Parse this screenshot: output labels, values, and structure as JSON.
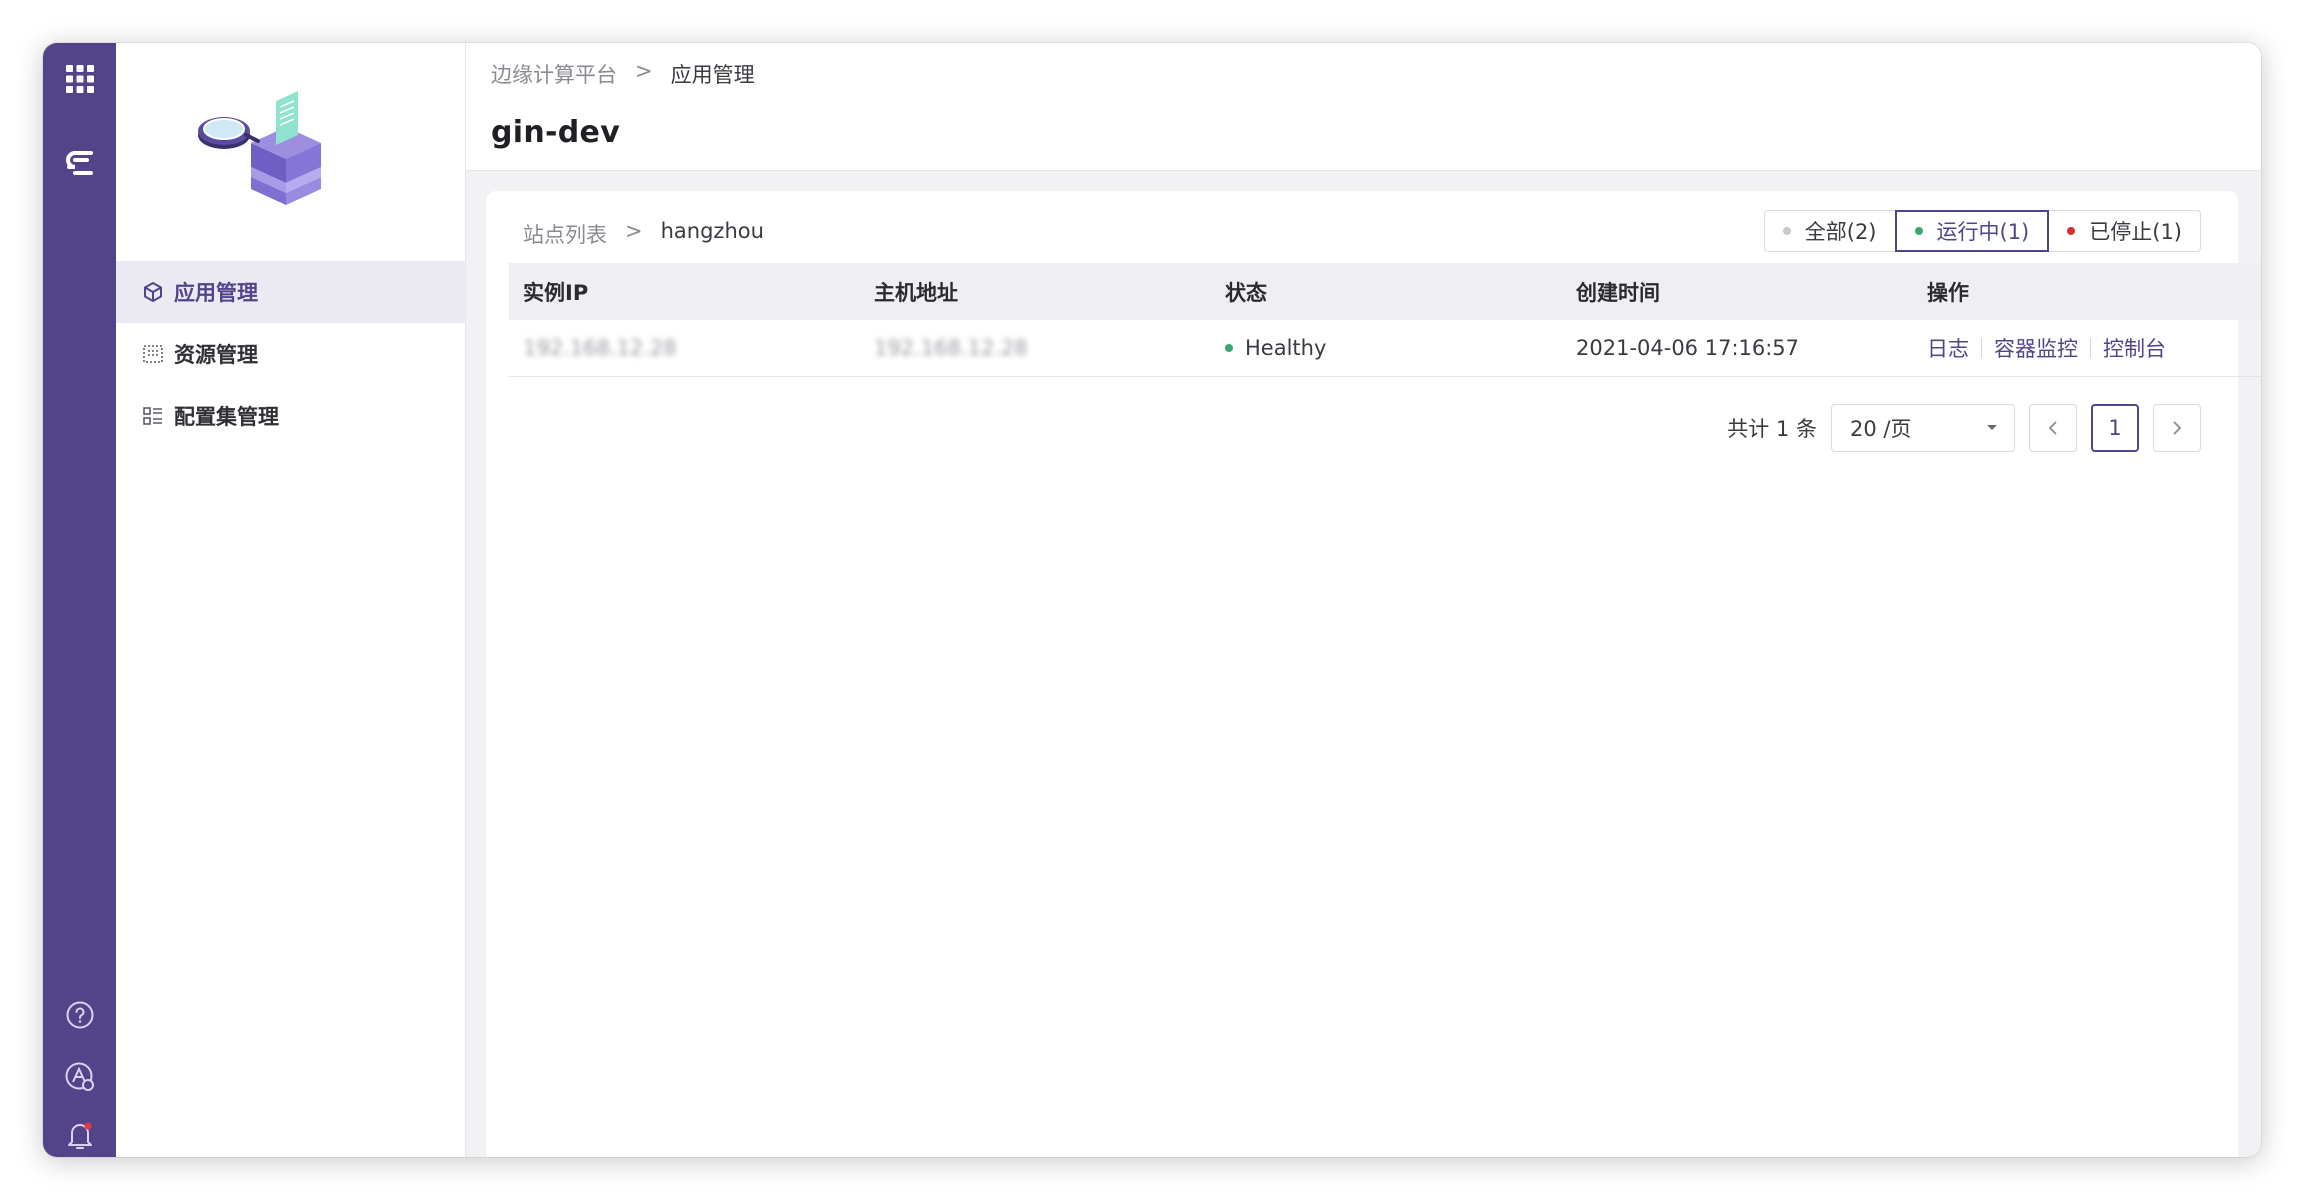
{
  "colors": {
    "accent": "#53448a",
    "healthy": "#3aa76d",
    "stopped": "#d2322d",
    "all": "#c9c9ce"
  },
  "rail": {
    "icons": [
      "apps-grid-icon",
      "brand-e-icon",
      "help-circle-icon",
      "account-settings-icon",
      "bell-icon"
    ]
  },
  "sidebar": {
    "items": [
      {
        "label": "应用管理",
        "icon": "cube-icon",
        "active": true
      },
      {
        "label": "资源管理",
        "icon": "resource-grid-icon",
        "active": false
      },
      {
        "label": "配置集管理",
        "icon": "config-list-icon",
        "active": false
      }
    ]
  },
  "header": {
    "breadcrumb": {
      "root": "边缘计算平台",
      "separator": ">",
      "current": "应用管理"
    },
    "title": "gin-dev"
  },
  "panel": {
    "breadcrumb": {
      "root": "站点列表",
      "separator": ">",
      "current": "hangzhou"
    },
    "filters": [
      {
        "label": "全部(2)",
        "dot": "#c9c9ce",
        "active": false
      },
      {
        "label": "运行中(1)",
        "dot": "#3aa76d",
        "active": true
      },
      {
        "label": "已停止(1)",
        "dot": "#d2322d",
        "active": false
      }
    ],
    "table": {
      "columns": [
        "实例IP",
        "主机地址",
        "状态",
        "创建时间",
        "操作"
      ],
      "rows": [
        {
          "ip": "192.168.12.28",
          "host": "192.168.12.28",
          "status": "Healthy",
          "created": "2021-04-06 17:16:57",
          "actions": [
            "日志",
            "容器监控",
            "控制台"
          ]
        }
      ]
    },
    "pagination": {
      "total_label": "共计 1 条",
      "page_size": "20 /页",
      "current_page": "1"
    }
  }
}
